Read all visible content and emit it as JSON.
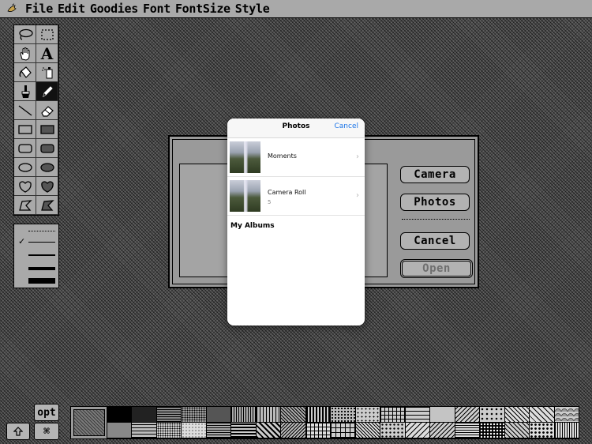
{
  "menubar": {
    "apple_icon": "apple-logo-icon",
    "items": [
      "File",
      "Edit",
      "Goodies",
      "Font",
      "FontSize",
      "Style"
    ]
  },
  "tools": [
    {
      "name": "lasso-tool-icon"
    },
    {
      "name": "marquee-tool-icon"
    },
    {
      "name": "hand-tool-icon"
    },
    {
      "name": "text-tool-icon"
    },
    {
      "name": "paint-bucket-tool-icon"
    },
    {
      "name": "spray-can-tool-icon"
    },
    {
      "name": "paintbrush-tool-icon"
    },
    {
      "name": "pencil-tool-icon"
    },
    {
      "name": "line-tool-icon"
    },
    {
      "name": "eraser-tool-icon"
    },
    {
      "name": "rectangle-tool-icon"
    },
    {
      "name": "filled-rectangle-tool-icon"
    },
    {
      "name": "rounded-rectangle-tool-icon"
    },
    {
      "name": "filled-rounded-rectangle-tool-icon"
    },
    {
      "name": "oval-tool-icon"
    },
    {
      "name": "filled-oval-tool-icon"
    },
    {
      "name": "freeform-tool-icon"
    },
    {
      "name": "filled-freeform-tool-icon"
    },
    {
      "name": "polygon-tool-icon"
    },
    {
      "name": "filled-polygon-tool-icon"
    }
  ],
  "selected_tool": "pencil-tool-icon",
  "line_widths": {
    "selected_index": 1,
    "check_icon": "checkmark-icon"
  },
  "file_dialog": {
    "buttons": {
      "camera": "Camera",
      "photos": "Photos",
      "cancel": "Cancel",
      "open": "Open"
    },
    "open_enabled": false
  },
  "photo_picker": {
    "title": "Photos",
    "cancel": "Cancel",
    "albums": [
      {
        "name": "Moments",
        "count": ""
      },
      {
        "name": "Camera Roll",
        "count": "5"
      }
    ],
    "section_header": "My Albums"
  },
  "keys": {
    "option": "opt",
    "shift_icon": "shift-arrow-icon",
    "command_icon": "command-icon"
  },
  "pattern_palette": {
    "count": 38
  }
}
